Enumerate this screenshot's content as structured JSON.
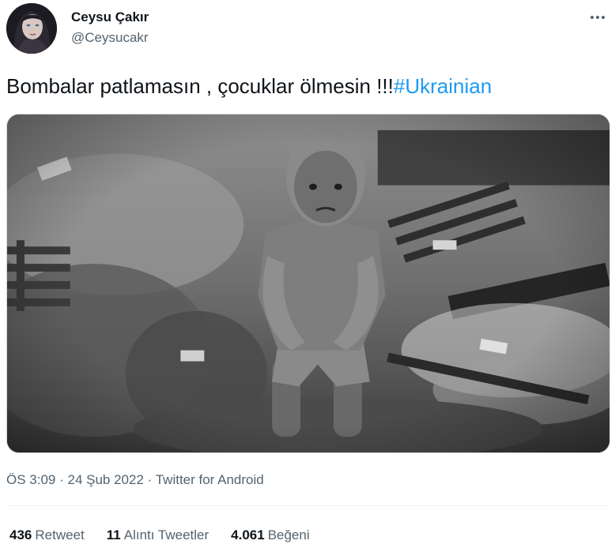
{
  "author": {
    "name": "Ceysu Çakır",
    "handle": "@Ceysucakr"
  },
  "tweet": {
    "text": "Bombalar patlamasın , çocuklar ölmesin !!!",
    "hashtag": "#Ukrainian"
  },
  "meta": {
    "time": "ÖS 3:09",
    "separator1": " · ",
    "date": "24 Şub 2022",
    "separator2": " · ",
    "source": "Twitter for Android"
  },
  "stats": {
    "retweets_count": "436",
    "retweets_label": "Retweet",
    "quotes_count": "11",
    "quotes_label": "Alıntı Tweetler",
    "likes_count": "4.061",
    "likes_label": "Beğeni"
  }
}
